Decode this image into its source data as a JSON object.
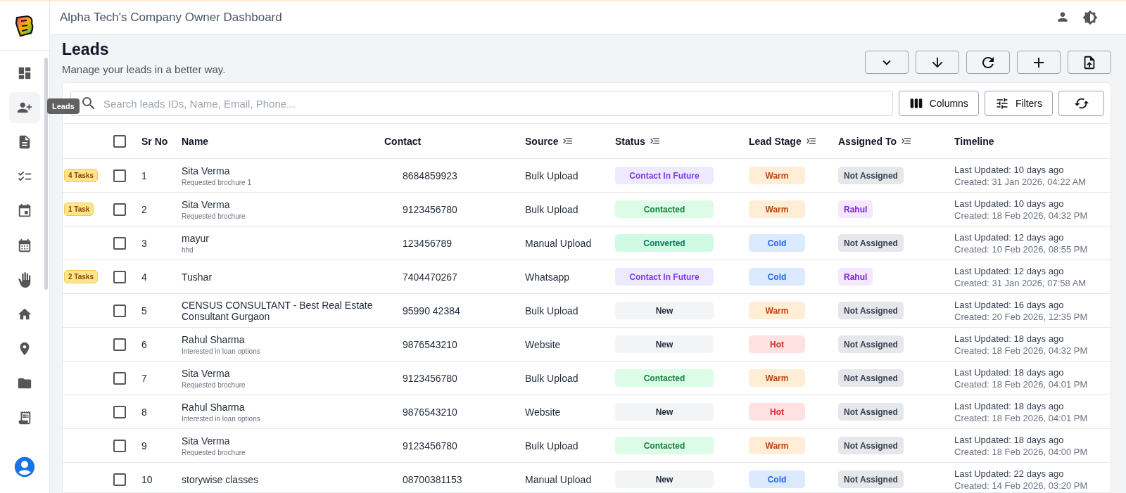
{
  "app": {
    "title": "Alpha Tech's Company Owner Dashboard"
  },
  "sidebar": {
    "tooltip": "Leads",
    "items": [
      {
        "kind": "dashboard",
        "selected": false
      },
      {
        "kind": "leads",
        "selected": true
      },
      {
        "kind": "document",
        "selected": false
      },
      {
        "kind": "checklist",
        "selected": false
      },
      {
        "kind": "event",
        "selected": false
      },
      {
        "kind": "calendar",
        "selected": false
      },
      {
        "kind": "hand",
        "selected": false
      },
      {
        "kind": "home",
        "selected": false
      },
      {
        "kind": "location",
        "selected": false
      },
      {
        "kind": "folder",
        "selected": false
      },
      {
        "kind": "receipt",
        "selected": false
      }
    ]
  },
  "page": {
    "title": "Leads",
    "subtitle": "Manage your leads in a better way."
  },
  "search": {
    "placeholder": "Search leads IDs, Name, Email, Phone..."
  },
  "controls": {
    "columns": "Columns",
    "filters": "Filters"
  },
  "table": {
    "select_all_checked": false,
    "columns": [
      {
        "label": "Sr No",
        "filterable": false
      },
      {
        "label": "Name",
        "filterable": false
      },
      {
        "label": "Contact",
        "filterable": false
      },
      {
        "label": "Source",
        "filterable": true
      },
      {
        "label": "Status",
        "filterable": true
      },
      {
        "label": "Lead Stage",
        "filterable": true
      },
      {
        "label": "Assigned To",
        "filterable": true
      },
      {
        "label": "Timeline",
        "filterable": false
      }
    ],
    "rows": [
      {
        "tasks": "4 Tasks",
        "checked": false,
        "sr": "1",
        "name": "Sita Verma",
        "note": "Requested brochure 1",
        "contact": "8684859923",
        "source": "Bulk Upload",
        "status": {
          "label": "Contact In Future",
          "kind": "future"
        },
        "stage": {
          "label": "Warm",
          "kind": "warm"
        },
        "assigned": {
          "label": "Not Assigned",
          "kind": "none"
        },
        "updated": "Last Updated: 10 days ago",
        "created": "Created: 31 Jan 2026, 04:22 AM"
      },
      {
        "tasks": "1 Task",
        "checked": false,
        "sr": "2",
        "name": "Sita Verma",
        "note": "Requested brochure",
        "contact": "9123456780",
        "source": "Bulk Upload",
        "status": {
          "label": "Contacted",
          "kind": "contacted"
        },
        "stage": {
          "label": "Warm",
          "kind": "warm"
        },
        "assigned": {
          "label": "Rahul",
          "kind": "person"
        },
        "updated": "Last Updated: 10 days ago",
        "created": "Created: 18 Feb 2026, 04:32 PM"
      },
      {
        "checked": false,
        "sr": "3",
        "name": "mayur",
        "note": "hhd",
        "contact": "123456789",
        "source": "Manual Upload",
        "status": {
          "label": "Converted",
          "kind": "converted"
        },
        "stage": {
          "label": "Cold",
          "kind": "cold"
        },
        "assigned": {
          "label": "Not Assigned",
          "kind": "none"
        },
        "updated": "Last Updated: 12 days ago",
        "created": "Created: 10 Feb 2026, 08:55 PM"
      },
      {
        "tasks": "2 Tasks",
        "checked": false,
        "sr": "4",
        "name": "Tushar",
        "contact": "7404470267",
        "source": "Whatsapp",
        "status": {
          "label": "Contact In Future",
          "kind": "future"
        },
        "stage": {
          "label": "Cold",
          "kind": "cold"
        },
        "assigned": {
          "label": "Rahul",
          "kind": "person"
        },
        "updated": "Last Updated: 12 days ago",
        "created": "Created: 31 Jan 2026, 07:58 AM"
      },
      {
        "checked": false,
        "sr": "5",
        "name": "CENSUS CONSULTANT - Best Real Estate Consultant Gurgaon",
        "contact": "95990 42384",
        "source": "Bulk Upload",
        "status": {
          "label": "New",
          "kind": "new"
        },
        "stage": {
          "label": "Warm",
          "kind": "warm"
        },
        "assigned": {
          "label": "Not Assigned",
          "kind": "none"
        },
        "updated": "Last Updated: 16 days ago",
        "created": "Created: 20 Feb 2026, 12:35 PM"
      },
      {
        "checked": false,
        "sr": "6",
        "name": "Rahul Sharma",
        "note": "Interested in loan options",
        "contact": "9876543210",
        "source": "Website",
        "status": {
          "label": "New",
          "kind": "new"
        },
        "stage": {
          "label": "Hot",
          "kind": "hot"
        },
        "assigned": {
          "label": "Not Assigned",
          "kind": "none"
        },
        "updated": "Last Updated: 18 days ago",
        "created": "Created: 18 Feb 2026, 04:32 PM"
      },
      {
        "checked": false,
        "sr": "7",
        "name": "Sita Verma",
        "note": "Requested brochure",
        "contact": "9123456780",
        "source": "Bulk Upload",
        "status": {
          "label": "Contacted",
          "kind": "contacted"
        },
        "stage": {
          "label": "Warm",
          "kind": "warm"
        },
        "assigned": {
          "label": "Not Assigned",
          "kind": "none"
        },
        "updated": "Last Updated: 18 days ago",
        "created": "Created: 18 Feb 2026, 04:01 PM"
      },
      {
        "checked": false,
        "sr": "8",
        "name": "Rahul Sharma",
        "note": "Interested in loan options",
        "contact": "9876543210",
        "source": "Website",
        "status": {
          "label": "New",
          "kind": "new"
        },
        "stage": {
          "label": "Hot",
          "kind": "hot"
        },
        "assigned": {
          "label": "Not Assigned",
          "kind": "none"
        },
        "updated": "Last Updated: 18 days ago",
        "created": "Created: 18 Feb 2026, 04:01 PM"
      },
      {
        "checked": false,
        "sr": "9",
        "name": "Sita Verma",
        "note": "Requested brochure",
        "contact": "9123456780",
        "source": "Bulk Upload",
        "status": {
          "label": "Contacted",
          "kind": "contacted"
        },
        "stage": {
          "label": "Warm",
          "kind": "warm"
        },
        "assigned": {
          "label": "Not Assigned",
          "kind": "none"
        },
        "updated": "Last Updated: 18 days ago",
        "created": "Created: 18 Feb 2026, 04:00 PM"
      },
      {
        "checked": false,
        "sr": "10",
        "name": "storywise classes",
        "contact": "08700381153",
        "source": "Manual Upload",
        "status": {
          "label": "New",
          "kind": "new"
        },
        "stage": {
          "label": "Cold",
          "kind": "cold"
        },
        "assigned": {
          "label": "Not Assigned",
          "kind": "none"
        },
        "updated": "Last Updated: 22 days ago",
        "created": "Created: 14 Feb 2026, 03:20 PM"
      }
    ]
  }
}
